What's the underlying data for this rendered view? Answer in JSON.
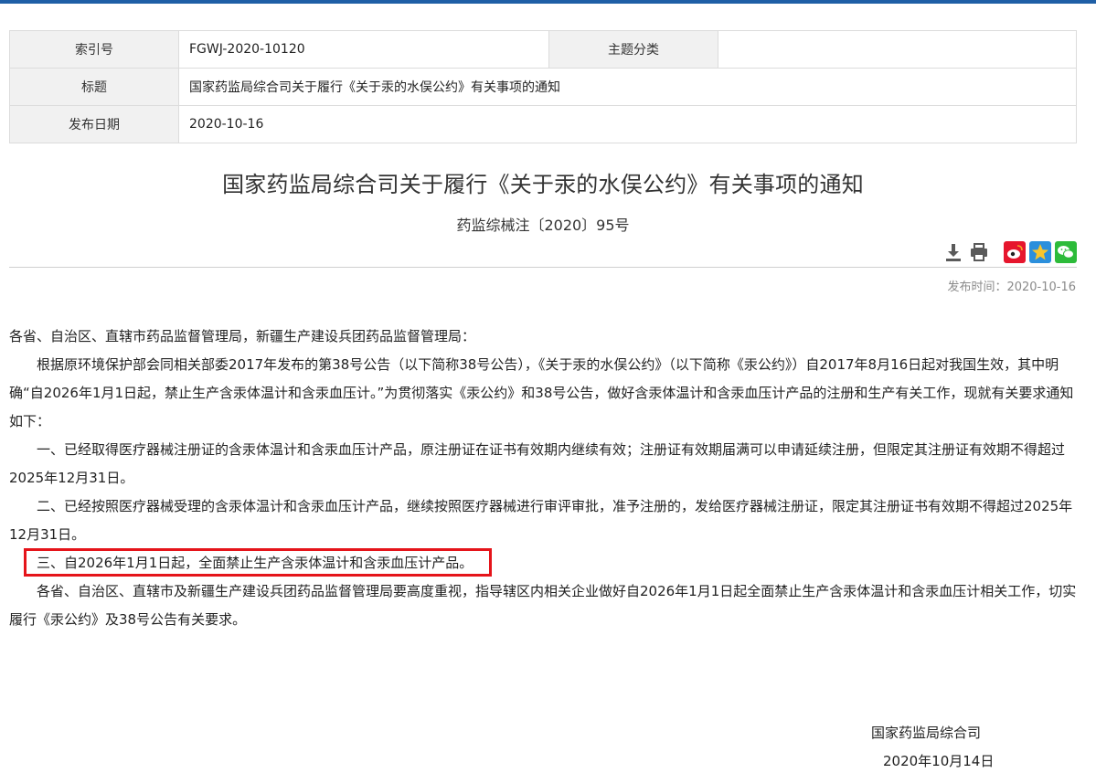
{
  "meta_table": {
    "index_label": "索引号",
    "index_value": "FGWJ-2020-10120",
    "category_label": "主题分类",
    "category_value": "",
    "title_label": "标题",
    "title_value": "国家药监局综合司关于履行《关于汞的水俣公约》有关事项的通知",
    "date_label": "发布日期",
    "date_value": "2020-10-16"
  },
  "document": {
    "title": "国家药监局综合司关于履行《关于汞的水俣公约》有关事项的通知",
    "number": "药监综械注〔2020〕95号",
    "publish_time": "发布时间：2020-10-16"
  },
  "toolbar": {
    "icons": [
      "download-icon",
      "print-icon",
      "weibo-icon",
      "qzone-icon",
      "wechat-icon"
    ],
    "colors": {
      "icon_gray": "#5a5a5a",
      "weibo": "#e6162d",
      "qzone": "#2b8fdc",
      "wechat": "#2dbb3a"
    }
  },
  "body": {
    "salutation": "各省、自治区、直辖市药品监督管理局，新疆生产建设兵团药品监督管理局：",
    "intro": "根据原环境保护部会同相关部委2017年发布的第38号公告（以下简称38号公告），《关于汞的水俣公约》（以下简称《汞公约》）自2017年8月16日起对我国生效，其中明确“自2026年1月1日起，禁止生产含汞体温计和含汞血压计。”为贯彻落实《汞公约》和38号公告，做好含汞体温计和含汞血压计产品的注册和生产有关工作，现就有关要求通知如下：",
    "item1": "一、已经取得医疗器械注册证的含汞体温计和含汞血压计产品，原注册证在证书有效期内继续有效；注册证有效期届满可以申请延续注册，但限定其注册证有效期不得超过2025年12月31日。",
    "item2": "二、已经按照医疗器械受理的含汞体温计和含汞血压计产品，继续按照医疗器械进行审评审批，准予注册的，发给医疗器械注册证，限定其注册证书有效期不得超过2025年12月31日。",
    "item3": "三、自2026年1月1日起，全面禁止生产含汞体温计和含汞血压计产品。",
    "closing": "各省、自治区、直辖市及新疆生产建设兵团药品监督管理局要高度重视，指导辖区内相关企业做好自2026年1月1日起全面禁止生产含汞体温计和含汞血压计相关工作，切实履行《汞公约》及38号公告有关要求。"
  },
  "signature": {
    "org": "国家药监局综合司",
    "date": "2020年10月14日"
  },
  "colors": {
    "top_bar": "#1f5fa6",
    "highlight": "#e5141a",
    "label_bg": "#f1f1f1"
  }
}
